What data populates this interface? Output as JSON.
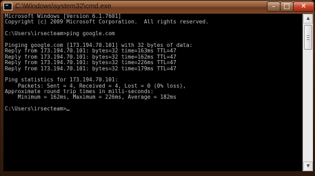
{
  "window": {
    "title": "C:\\Windows\\system32\\cmd.exe",
    "controls": {
      "minimize": "–",
      "maximize": "□",
      "close": "✕"
    }
  },
  "console": {
    "text_color": "#c0c0c0",
    "background": "#000000",
    "lines": [
      "Microsoft Windows [Version 6.1.7601]",
      "Copyright (c) 2009 Microsoft Corporation.  All rights reserved.",
      "",
      "C:\\Users\\irsecteam>ping google.com",
      "",
      "Pinging google.com [173.194.70.101] with 32 bytes of data:",
      "Reply from 173.194.70.101: bytes=32 time=163ms TTL=47",
      "Reply from 173.194.70.101: bytes=32 time=162ms TTL=47",
      "Reply from 173.194.70.101: bytes=32 time=226ms TTL=47",
      "Reply from 173.194.70.101: bytes=32 time=179ms TTL=47",
      "",
      "Ping statistics for 173.194.70.101:",
      "    Packets: Sent = 4, Received = 4, Lost = 0 (0% loss),",
      "Approximate round trip times in milli-seconds:",
      "    Minimum = 162ms, Maximum = 226ms, Average = 182ms",
      "",
      "C:\\Users\\irsecteam>"
    ]
  },
  "scrollbar": {
    "up_arrow": "▲",
    "down_arrow": "▼"
  }
}
